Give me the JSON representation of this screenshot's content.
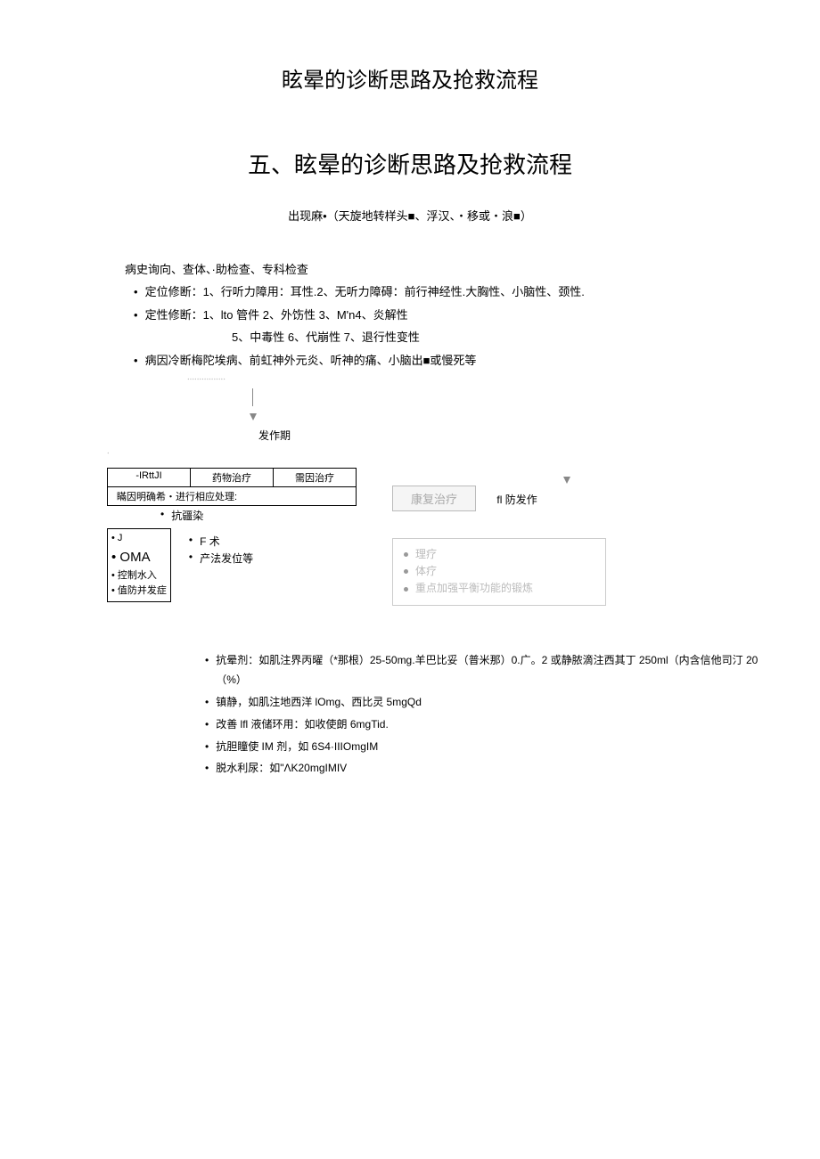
{
  "page_title": "眩晕的诊断思路及抢救流程",
  "section_title": "五、眩晕的诊断思路及抢救流程",
  "subtitle": "出现麻•（天旋地转样头■、浮汉、・移或・浪■）",
  "history_line": "病史询向、查体、·助检查、专科检查",
  "diag_lines": [
    "定位修断：1、行听力障用：耳性.2、无听力障碍：前行神经性.大胸性、小脑性、颈性.",
    "定性修断：1、lto 管件 2、外饬性 3、M'n4、炎解性",
    "病因冷断梅陀埃病、前虹神外元炎、听神的痛、小脑出■或慢死等"
  ],
  "diag_sub": "5、中毒性 6、代崩性 7、退行性变性",
  "phase": "发作期",
  "left_box": {
    "cells": [
      "-IRttJI",
      "药物治疗",
      "需因治疗"
    ],
    "note": "瞞因明确希・进行相应处理:",
    "anti": "抗疆染",
    "small_items": [
      "J",
      "OMA",
      "控制水入",
      "值防并发症"
    ],
    "right_items": [
      "F 术",
      "产法发位等"
    ]
  },
  "right_box": {
    "recover": "康复治疗",
    "prevent": "fl 防发作",
    "items": [
      "理疗",
      "体疗",
      "重点加强平衡功能的锻炼"
    ]
  },
  "meds": [
    "抗晕剂：如肌注界丙曜（*那根）25-50mg.羊巴比妥（普米那）0.广。2 或静脓滴注西其丁 250ml（内含信他司汀 20（%）",
    "镇静，如肌注地西洋 lOmg、西比灵 5mgQd",
    "改善 lfl 液储环用：如收使朗 6mgTid.",
    "抗胆瞳使 IM 剂，如 6S4·IIIOmgIM",
    "脱水利尿：如\"ΛK20mgIMIV"
  ]
}
